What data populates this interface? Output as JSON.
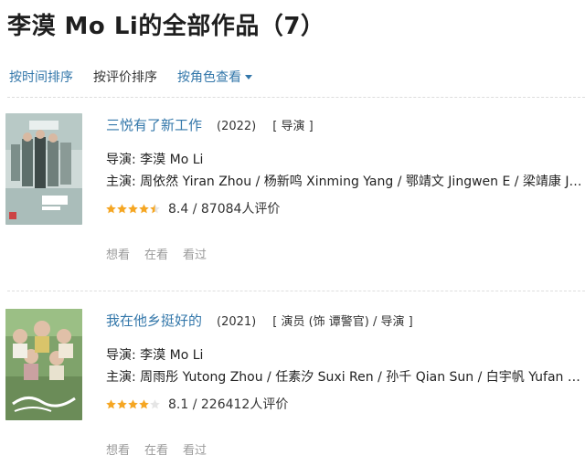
{
  "page": {
    "title": "李漠 Mo Li的全部作品（7）"
  },
  "sort_bar": {
    "by_time": "按时间排序",
    "by_rating": "按评价排序",
    "by_role": "按角色查看"
  },
  "colors": {
    "link": "#3377aa",
    "star": "#f5a623",
    "muted": "#9a9a9a"
  },
  "works": [
    {
      "title": "三悦有了新工作",
      "year": "(2022)",
      "role": "[ 导演 ]",
      "director": "导演: 李漠 Mo Li",
      "cast": "主演: 周依然 Yiran Zhou / 杨新鸣 Xinming Yang / 鄂靖文 Jingwen E / 梁靖康 Jing...",
      "rating_value": 8.4,
      "stars_filled": 4.5,
      "rating_text": "8.4 / 87084人评价",
      "actions": [
        "想看",
        "在看",
        "看过"
      ],
      "poster_icon": "movie-poster"
    },
    {
      "title": "我在他乡挺好的",
      "year": "(2021)",
      "role": "[ 演员 (饰 谭警官) / 导演 ]",
      "director": "导演: 李漠 Mo Li",
      "cast": "主演: 周雨彤 Yutong Zhou / 任素汐 Suxi Ren / 孙千 Qian Sun / 白宇帆 Yufan Bai ...",
      "rating_value": 8.1,
      "stars_filled": 4.0,
      "rating_text": "8.1 / 226412人评价",
      "actions": [
        "想看",
        "在看",
        "看过"
      ],
      "poster_icon": "movie-poster"
    }
  ]
}
